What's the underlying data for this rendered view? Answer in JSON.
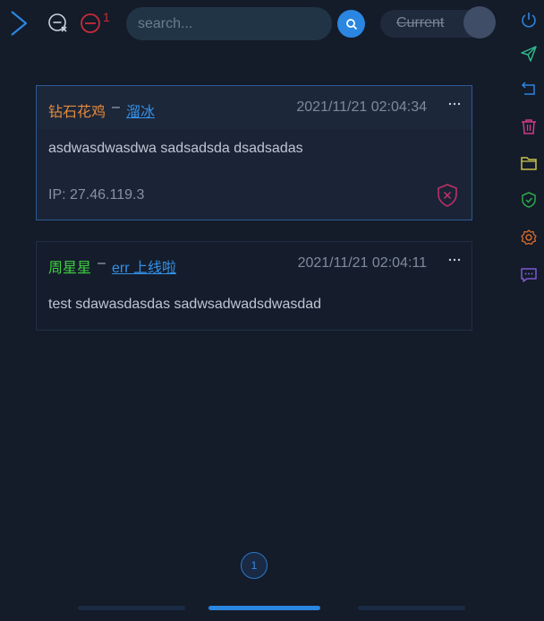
{
  "toolbar": {
    "block_count": "1",
    "search_placeholder": "search...",
    "toggle_label": "Current"
  },
  "messages": [
    {
      "username": "钻石花鸡",
      "separator": "–",
      "nick": "溜冰",
      "timestamp": "2021/11/21 02:04:34",
      "content": "asdwasdwasdwa sadsadsda dsadsadas",
      "ip": "IP: 27.46.119.3",
      "username_color": "#e58a3a",
      "selected": true
    },
    {
      "username": "周星星",
      "separator": "–",
      "nick": "err 上线啦",
      "timestamp": "2021/11/21 02:04:11",
      "content": "test sdawasdasdas sadwsadwadsdwasdad",
      "username_color": "#3fcf3f",
      "selected": false
    }
  ],
  "pagination": {
    "current_page": "1"
  },
  "colors": {
    "background": "#141b29",
    "accent": "#2a86e0",
    "danger": "#c62c36"
  },
  "sidebar_icons": [
    "power-icon",
    "send-icon",
    "return-icon",
    "trash-icon",
    "folder-icon",
    "shield-check-icon",
    "settings-icon",
    "message-icon"
  ]
}
